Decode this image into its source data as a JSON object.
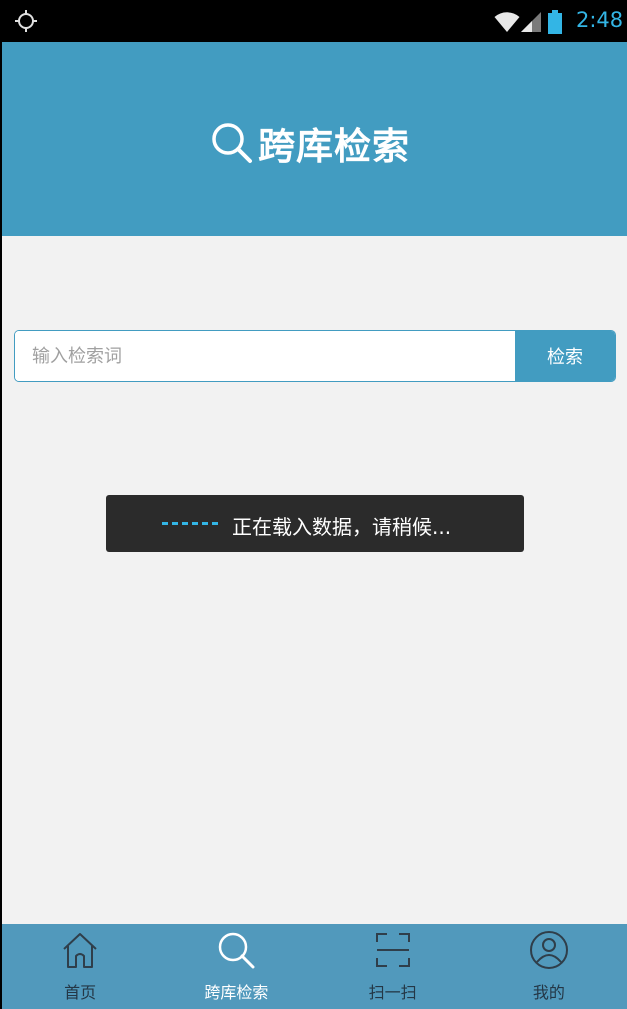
{
  "status_bar": {
    "time": "2:48",
    "icons": [
      "gps-icon",
      "wifi-icon",
      "signal-icon",
      "battery-icon"
    ],
    "accent_color": "#33b5e5"
  },
  "header": {
    "title": "跨库检索",
    "icon": "search-icon",
    "background_color": "#429cc1"
  },
  "search": {
    "placeholder": "输入检索词",
    "value": "",
    "button_label": "检索"
  },
  "toast": {
    "message": "正在载入数据，请稍候..."
  },
  "bottom_nav": {
    "items": [
      {
        "label": "首页",
        "icon": "home-icon",
        "active": false
      },
      {
        "label": "跨库检索",
        "icon": "search-icon",
        "active": true
      },
      {
        "label": "扫一扫",
        "icon": "scan-icon",
        "active": false
      },
      {
        "label": "我的",
        "icon": "user-icon",
        "active": false
      }
    ]
  }
}
